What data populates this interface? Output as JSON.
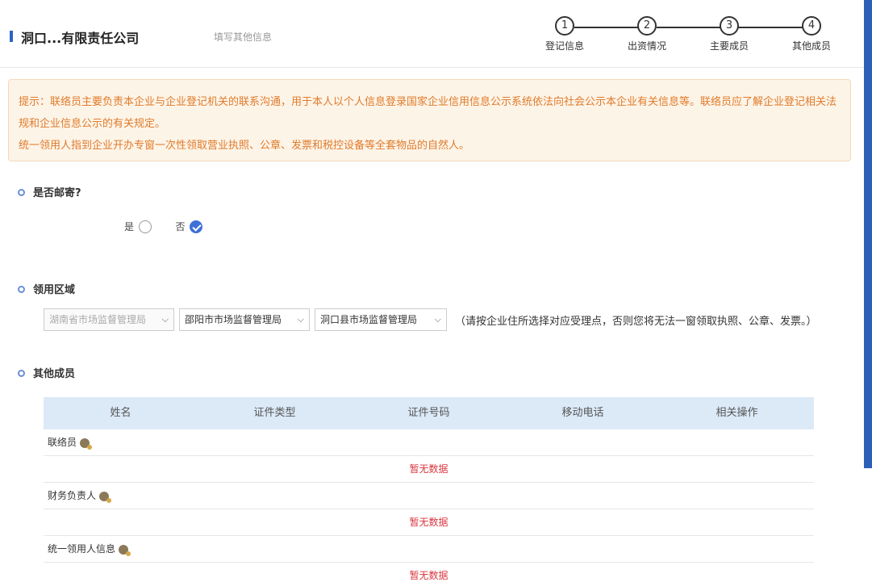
{
  "header": {
    "company_name": "洞口...有限责任公司",
    "subtitle": "填写其他信息"
  },
  "steps": [
    {
      "number": "1",
      "label": "登记信息"
    },
    {
      "number": "2",
      "label": "出资情况"
    },
    {
      "number": "3",
      "label": "主要成员"
    },
    {
      "number": "4",
      "label": "其他成员"
    }
  ],
  "notice": {
    "line1": "提示：联络员主要负责本企业与企业登记机关的联系沟通，用于本人以个人信息登录国家企业信用信息公示系统依法向社会公示本企业有关信息等。联络员应了解企业登记相关法规和企业信息公示的有关规定。",
    "line2": "统一领用人指到企业开办专窗一次性领取营业执照、公章、发票和税控设备等全套物品的自然人。"
  },
  "mail_section": {
    "title": "是否邮寄?",
    "yes_label": "是",
    "no_label": "否",
    "selected": "否"
  },
  "region_section": {
    "title": "领用区域",
    "province": "湖南省市场监督管理局",
    "city": "邵阳市市场监督管理局",
    "county": "洞口县市场监督管理局",
    "hint": "（请按企业住所选择对应受理点，否则您将无法一窗领取执照、公章、发票。）"
  },
  "members_section": {
    "title": "其他成员",
    "columns": [
      "姓名",
      "证件类型",
      "证件号码",
      "移动电话",
      "相关操作"
    ],
    "groups": [
      {
        "label": "联络员",
        "empty_text": "暂无数据"
      },
      {
        "label": "财务负责人",
        "empty_text": "暂无数据"
      },
      {
        "label": "统一领用人信息",
        "empty_text": "暂无数据"
      }
    ]
  },
  "colors": {
    "accent": "#2a63c9",
    "notice_text": "#e07b2a",
    "empty_text": "#d9363e",
    "table_header": "#dce9f7"
  }
}
